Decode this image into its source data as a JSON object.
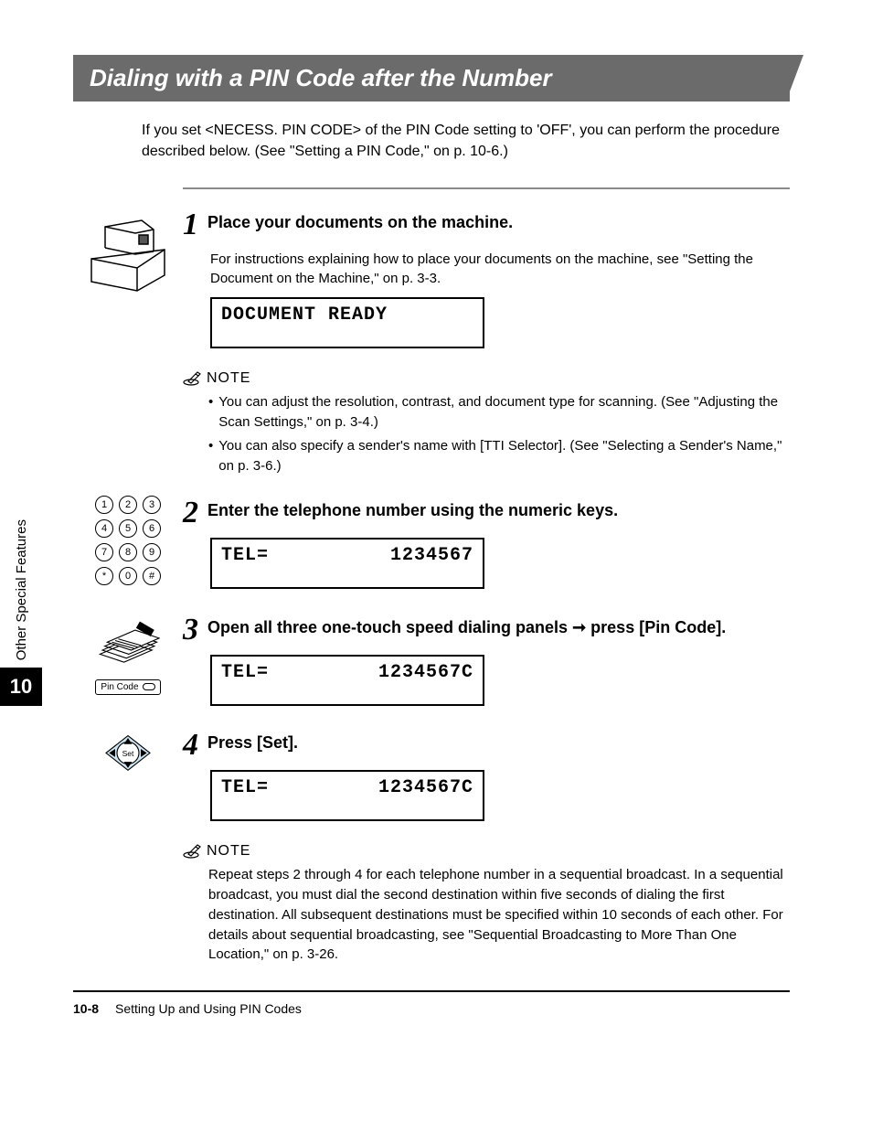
{
  "heading": "Dialing with a PIN Code after the Number",
  "intro": "If you set <NECESS. PIN CODE> of the PIN Code setting to 'OFF', you can perform the procedure described below. (See \"Setting a PIN Code,\" on p. 10-6.)",
  "steps": [
    {
      "num": "1",
      "title": "Place your documents on the machine.",
      "desc": "For instructions explaining how to place your documents on the machine, see \"Setting the Document on the Machine,\" on p. 3-3.",
      "lcd_left": "DOCUMENT READY",
      "lcd_right": ""
    },
    {
      "num": "2",
      "title": "Enter the telephone number using the numeric keys.",
      "lcd_left": "TEL=",
      "lcd_right": "1234567"
    },
    {
      "num": "3",
      "title_prefix": "Open all three one-touch speed dialing panels ",
      "title_suffix": " press [Pin Code].",
      "arrow": "➞",
      "lcd_left": "TEL=",
      "lcd_right": "1234567C"
    },
    {
      "num": "4",
      "title": "Press [Set].",
      "lcd_left": "TEL=",
      "lcd_right": "1234567C"
    }
  ],
  "note1": {
    "label": "NOTE",
    "items": [
      "You can adjust the resolution, contrast, and document type for scanning. (See \"Adjusting the Scan Settings,\" on p. 3-4.)",
      "You can also specify a sender's name with [TTI Selector]. (See \"Selecting a Sender's Name,\" on p. 3-6.)"
    ]
  },
  "note2": {
    "label": "NOTE",
    "text": "Repeat steps 2 through 4 for each telephone number in a sequential broadcast. In a sequential broadcast, you must dial the second destination within five seconds of dialing the first destination. All subsequent destinations must be specified within 10 seconds of each other. For details about sequential broadcasting, see \"Sequential Broadcasting to More Than One Location,\" on p. 3-26."
  },
  "side": {
    "label": "Other Special Features",
    "chapter": "10"
  },
  "keypad": [
    [
      "1",
      "2",
      "3"
    ],
    [
      "4",
      "5",
      "6"
    ],
    [
      "7",
      "8",
      "9"
    ],
    [
      "*",
      "0",
      "#"
    ]
  ],
  "pin_code_label": "Pin Code",
  "set_label": "Set",
  "footer": {
    "page": "10-8",
    "section": "Setting Up and Using PIN Codes"
  }
}
